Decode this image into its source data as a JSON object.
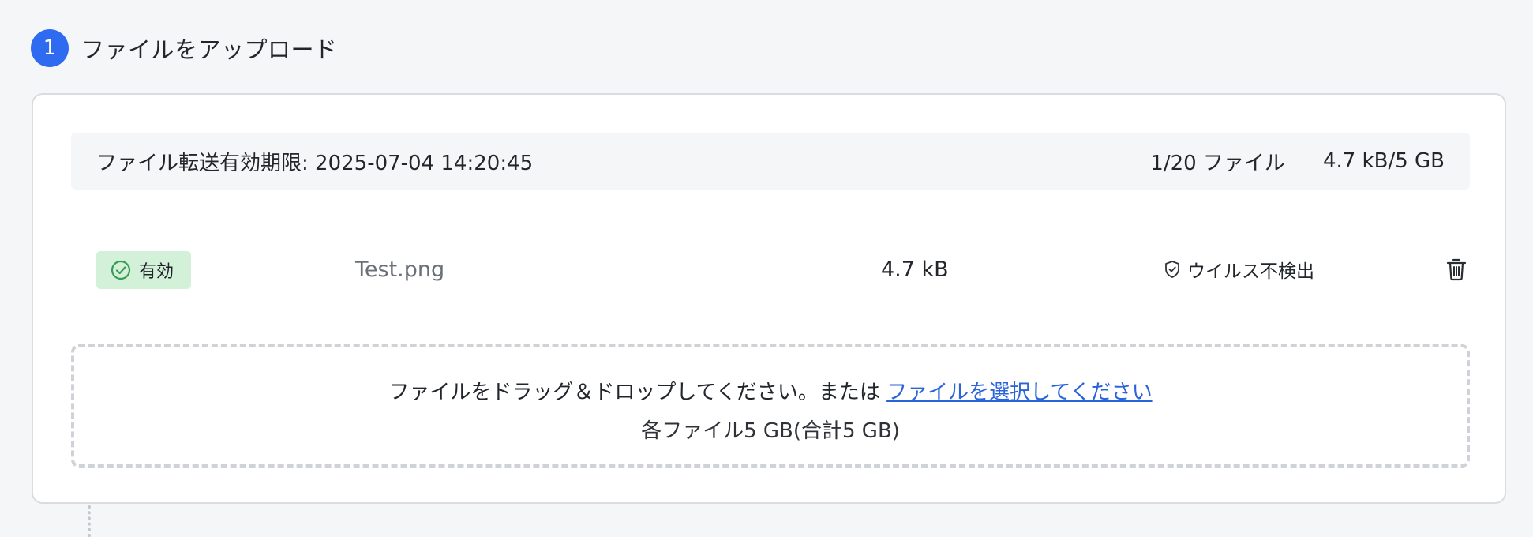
{
  "step": {
    "number": "1",
    "title": "ファイルをアップロード"
  },
  "info_bar": {
    "expiry": "ファイル転送有効期限: 2025-07-04 14:20:45",
    "file_count": "1/20 ファイル",
    "total_size": "4.7 kB/5 GB"
  },
  "files": [
    {
      "status_label": "有効",
      "status_icon": "check-circle-icon",
      "name": "Test.png",
      "size": "4.7 kB",
      "scan_label": "ウイルス不検出",
      "scan_icon": "shield-check-icon",
      "delete_icon": "trash-icon"
    }
  ],
  "dropzone": {
    "instruction": "ファイルをドラッグ＆ドロップしてください。または ",
    "select_link": "ファイルを選択してください",
    "limit_text": "各ファイル5 GB(合計5 GB)"
  },
  "colors": {
    "accent": "#2f6bf0",
    "link": "#2b63d9",
    "valid_badge_bg": "#d3f0d8",
    "valid_icon": "#3a9b52"
  }
}
